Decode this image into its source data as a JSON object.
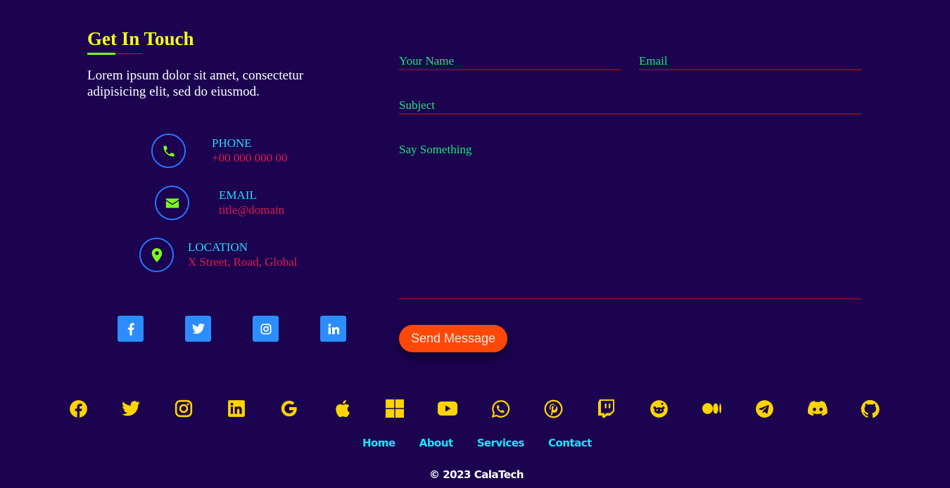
{
  "contact": {
    "title": "Get In Touch",
    "intro": "Lorem ipsum dolor sit amet, consectetur adipisicing elit, sed do eiusmod.",
    "items": [
      {
        "label": "PHONE",
        "value": "+00 000 000 00",
        "icon": "phone-icon"
      },
      {
        "label": "EMAIL",
        "value": "title@domain",
        "icon": "envelope-icon"
      },
      {
        "label": "LOCATION",
        "value": "X Street, Road, Global",
        "icon": "map-pin-icon"
      }
    ],
    "social": [
      "facebook-icon",
      "twitter-icon",
      "instagram-icon",
      "linkedin-icon"
    ]
  },
  "form": {
    "name_label": "Your Name",
    "email_label": "Email",
    "subject_label": "Subject",
    "message_label": "Say Something",
    "send_label": "Send Message"
  },
  "footer": {
    "icons": [
      "facebook-icon",
      "twitter-icon",
      "instagram-icon",
      "linkedin-icon",
      "google-icon",
      "apple-icon",
      "windows-icon",
      "youtube-icon",
      "whatsapp-icon",
      "pinterest-icon",
      "twitch-icon",
      "reddit-icon",
      "medium-icon",
      "telegram-icon",
      "discord-icon",
      "github-icon"
    ],
    "nav": [
      "Home",
      "About",
      "Services",
      "Contact"
    ],
    "copyright": "© 2023 CalaTech"
  },
  "colors": {
    "background": "#1b0350",
    "title": "#f5ff1f",
    "label": "#2ad6ff",
    "value": "#e01b4c",
    "form_label": "#22e07a",
    "button": "#ff4807",
    "social_button": "#2b8dff",
    "footer_icon": "#ffd500",
    "footer_link": "#17e6ff"
  }
}
